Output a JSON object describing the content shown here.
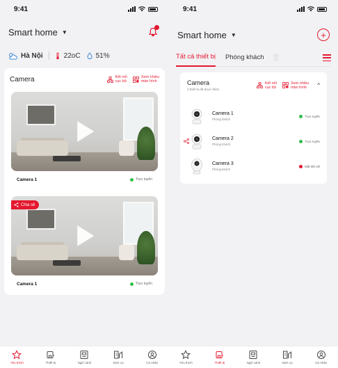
{
  "status_bar": {
    "time": "9:41"
  },
  "left": {
    "home_title": "Smart home",
    "weather": {
      "city": "Hà Nội",
      "temp": "22oC",
      "humidity": "51%"
    },
    "section_title": "Camera",
    "actions": {
      "connect_line1": "Kết nối",
      "connect_line2": "cục bộ",
      "multi_line1": "Xem nhiều",
      "multi_line2": "màn hình"
    },
    "cameras": [
      {
        "name": "Camera 1",
        "status": "Trực tuyến"
      },
      {
        "name": "Camera 1",
        "status": "Trực tuyến",
        "badge": "Chia sẻ"
      }
    ]
  },
  "right": {
    "home_title": "Smart home",
    "tabs": [
      "Tất cả thiết bị",
      "Phòng khách"
    ],
    "section_title": "Camera",
    "section_sub": "3 thiết bị đã được thêm",
    "actions": {
      "connect_line1": "Kết nối",
      "connect_line2": "cục bộ",
      "multi_line1": "Xem nhiều",
      "multi_line2": "màn hình"
    },
    "cameras": [
      {
        "name": "Camera 1",
        "room": "Phòng khách",
        "status": "Trực tuyến",
        "online": true
      },
      {
        "name": "Camera 2",
        "room": "Phòng khách",
        "status": "Trực tuyến",
        "online": true
      },
      {
        "name": "Camera 3",
        "room": "Phòng khách",
        "status": "Mất kết nối",
        "online": false
      }
    ]
  },
  "nav": [
    "Yêu thích",
    "Thiết bị",
    "Ngữ cảnh",
    "Dịch vụ",
    "Cá nhân"
  ],
  "colors": {
    "accent": "#e4182f",
    "online": "#2fbf4a",
    "offline": "#e4182f"
  }
}
